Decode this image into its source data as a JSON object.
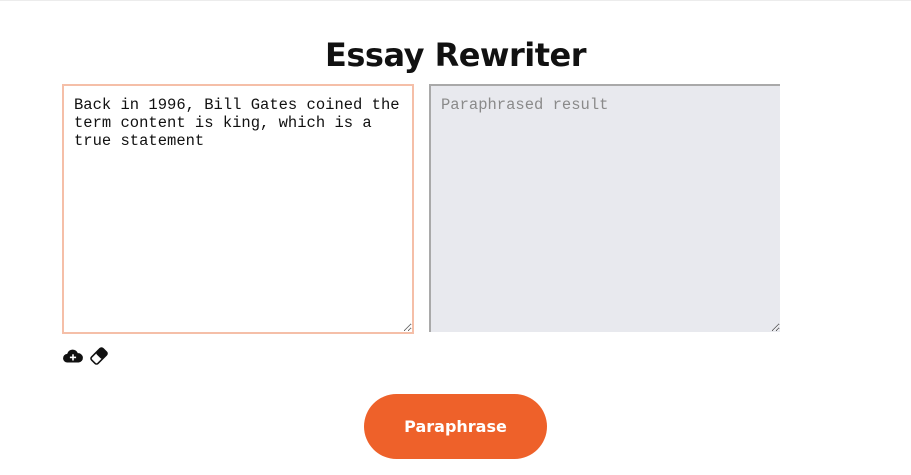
{
  "page": {
    "title": "Essay Rewriter"
  },
  "editor": {
    "input_value": "Back in 1996, Bill Gates coined the term content is king, which is a true statement",
    "output_placeholder": "Paraphrased result"
  },
  "tools": {
    "upload_icon": "cloud-upload-icon",
    "clear_icon": "eraser-icon"
  },
  "actions": {
    "paraphrase_label": "Paraphrase"
  },
  "colors": {
    "accent": "#ee612a",
    "input_border": "#f5bfa8",
    "output_background": "#e8e9ee"
  }
}
